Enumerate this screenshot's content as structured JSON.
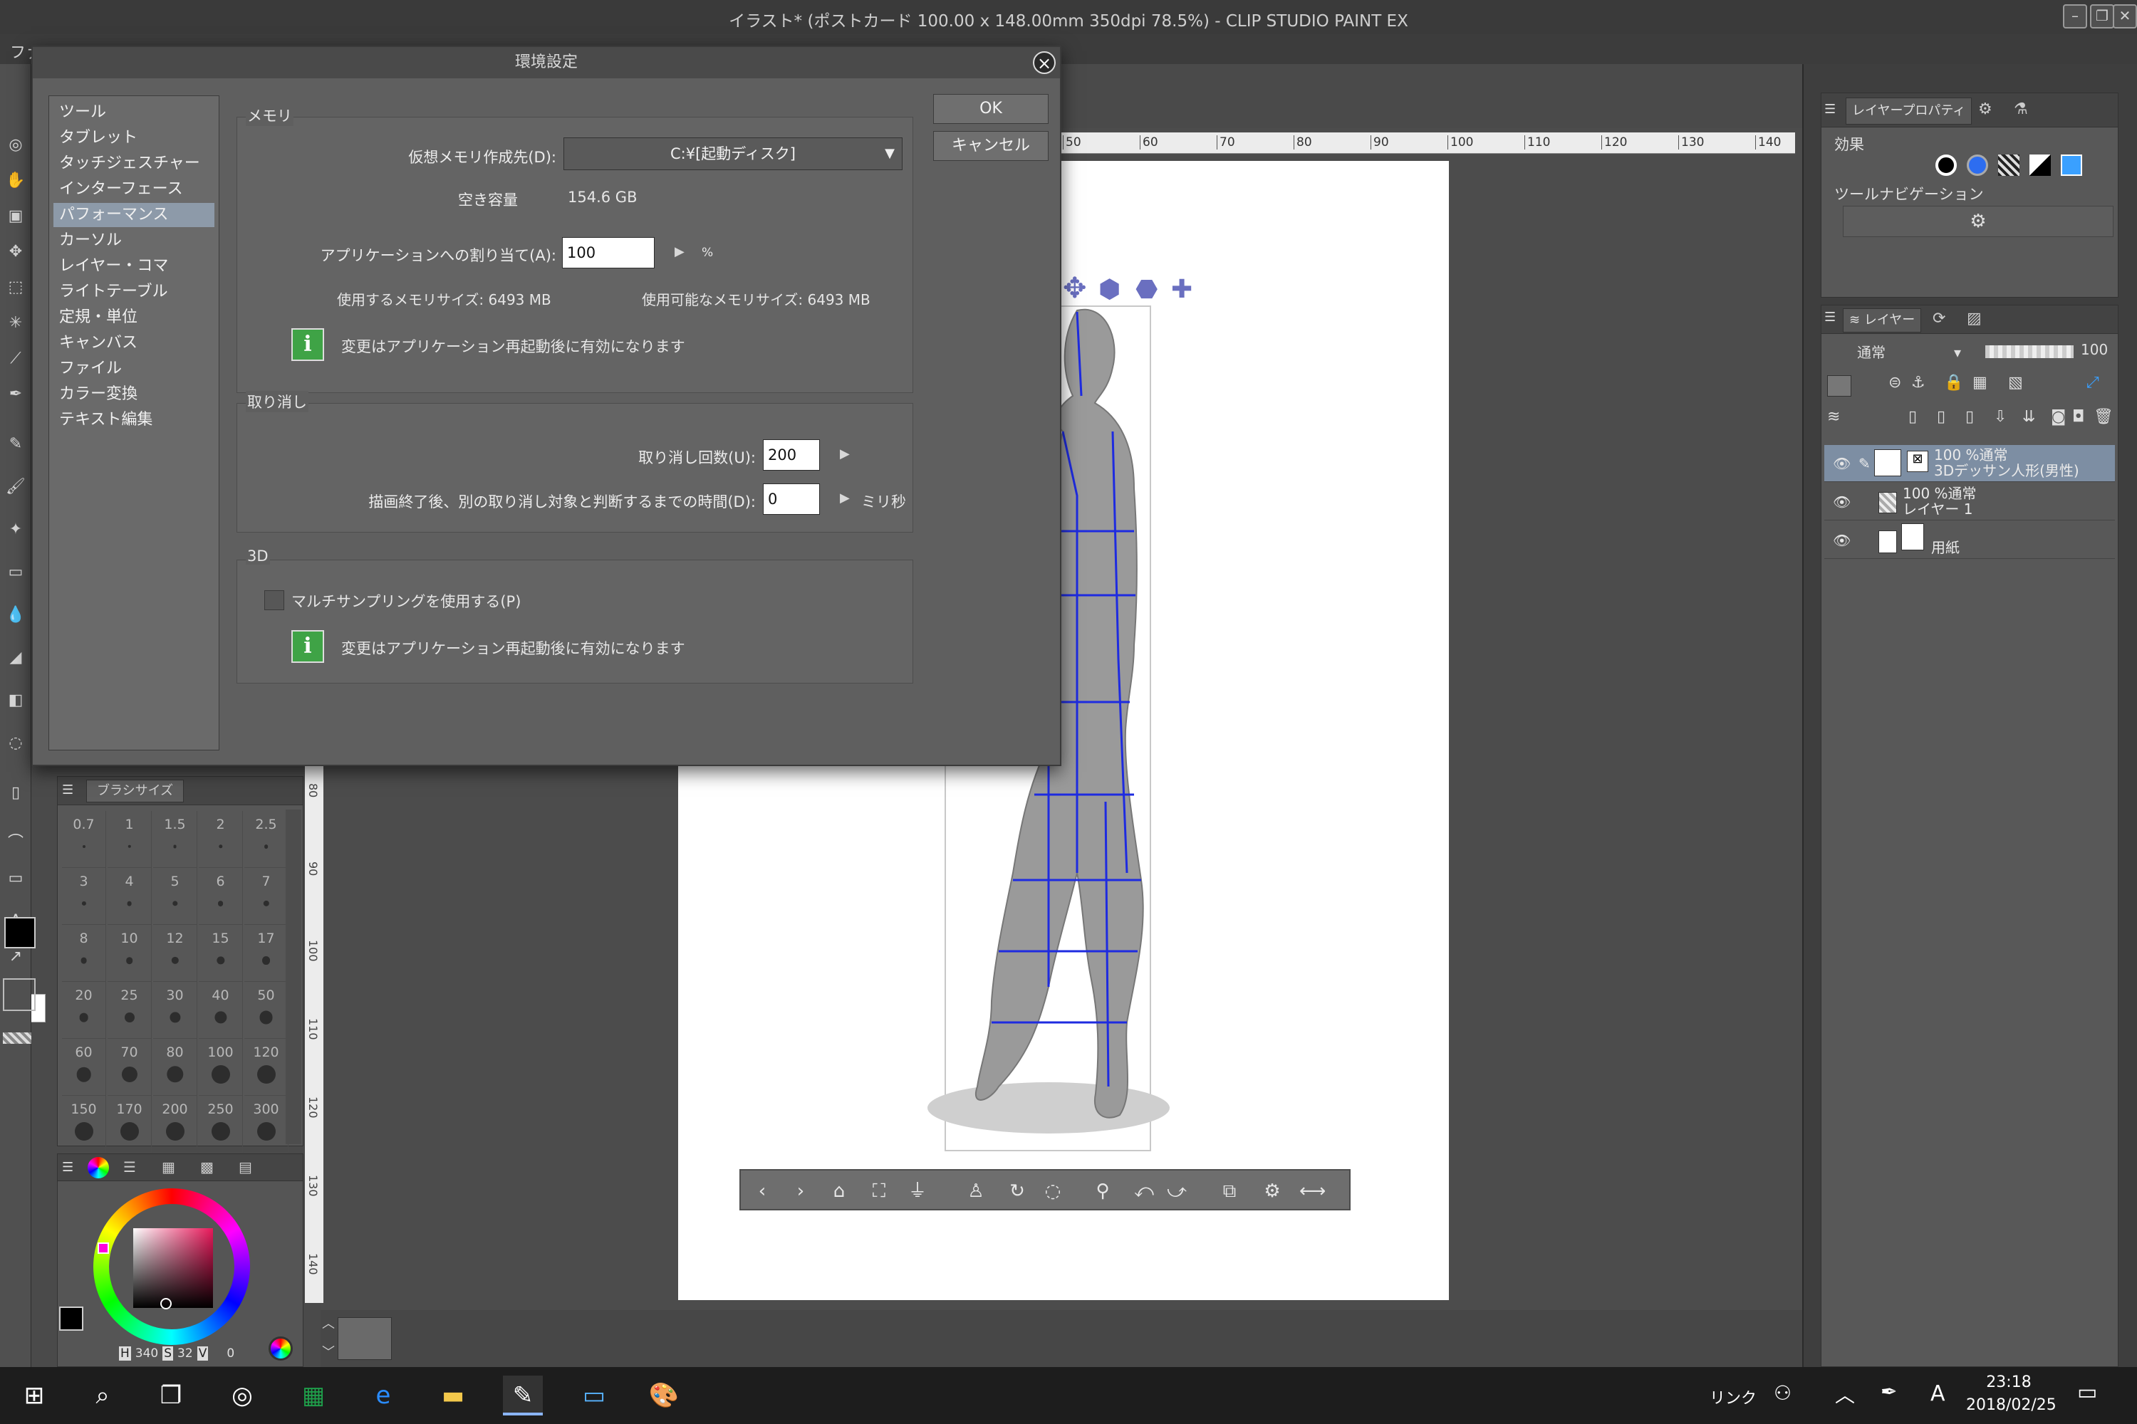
{
  "window": {
    "title": "イラスト* (ポストカード 100.00 x 148.00mm 350dpi 78.5%)  - CLIP STUDIO PAINT EX"
  },
  "menubar": {
    "first_label": "ファ"
  },
  "dialog": {
    "title": "環境設定",
    "nav": [
      "ツール",
      "タブレット",
      "タッチジェスチャー",
      "インターフェース",
      "パフォーマンス",
      "カーソル",
      "レイヤー・コマ",
      "ライトテーブル",
      "定規・単位",
      "キャンバス",
      "ファイル",
      "カラー変換",
      "テキスト編集"
    ],
    "selected_nav": "パフォーマンス",
    "memory": {
      "group_title": "メモリ",
      "vm_label": "仮想メモリ作成先(D):",
      "vm_value": "C:¥[起動ディスク]",
      "free_label": "空き容量",
      "free_value": "154.6 GB",
      "alloc_label": "アプリケーションへの割り当て(A):",
      "alloc_value": "100",
      "alloc_unit": "%",
      "used_text": "使用するメモリサイズ: 6493 MB",
      "avail_text": "使用可能なメモリサイズ: 6493 MB",
      "restart_note": "変更はアプリケーション再起動後に有効になります"
    },
    "undo": {
      "group_title": "取り消し",
      "count_label": "取り消し回数(U):",
      "count_value": "200",
      "time_label": "描画終了後、別の取り消し対象と判断するまでの時間(D):",
      "time_value": "0",
      "time_unit": "ミリ秒"
    },
    "three_d": {
      "group_title": "3D",
      "multisampling_label": "マルチサンプリングを使用する(P)",
      "multisampling_checked": false,
      "restart_note": "変更はアプリケーション再起動後に有効になります"
    },
    "ok_label": "OK",
    "cancel_label": "キャンセル"
  },
  "brush_panel": {
    "tab_label": "ブラシサイズ",
    "sizes": [
      "0.7",
      "1",
      "1.5",
      "2",
      "2.5",
      "3",
      "4",
      "5",
      "6",
      "7",
      "8",
      "10",
      "12",
      "15",
      "17",
      "20",
      "25",
      "30",
      "40",
      "50",
      "60",
      "70",
      "80",
      "100",
      "120",
      "150",
      "170",
      "200",
      "250",
      "300"
    ]
  },
  "color_panel": {
    "h_label": "H",
    "h_value": "340",
    "s_label": "S",
    "s_value": "32",
    "v_label": "V",
    "v_value": "0",
    "main_color": "#000000",
    "sub_color": "#ffffff"
  },
  "ruler": {
    "top_ticks": [
      "50",
      "60",
      "70",
      "80",
      "90",
      "100",
      "110",
      "120",
      "130",
      "140"
    ],
    "left_ticks": [
      "80",
      "90",
      "100",
      "110",
      "120",
      "130",
      "140"
    ]
  },
  "right": {
    "props_tab": "レイヤープロパティ",
    "effect_label": "効果",
    "toolnav_label": "ツールナビゲーション",
    "layer_tab": "レイヤー",
    "blend_mode": "通常",
    "opacity": "100",
    "layers": [
      {
        "line1": "100 %通常",
        "line2": "3Dデッサン人形(男性)",
        "selected": true
      },
      {
        "line1": "100 %通常",
        "line2": "レイヤー 1",
        "selected": false
      },
      {
        "line1": "",
        "line2": "用紙",
        "selected": false
      }
    ]
  },
  "taskbar": {
    "link_label": "リンク",
    "ime_label": "A",
    "time": "23:18",
    "date": "2018/02/25"
  }
}
